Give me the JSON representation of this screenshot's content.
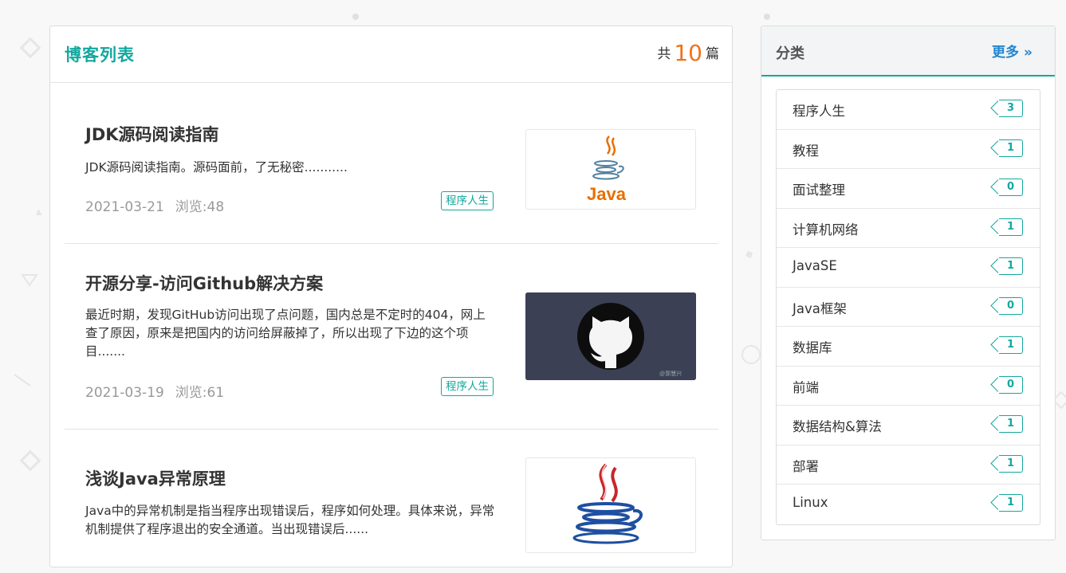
{
  "main": {
    "title": "博客列表",
    "total_prefix": "共",
    "total_count": "10",
    "total_suffix": "篇"
  },
  "posts": [
    {
      "title": "JDK源码阅读指南",
      "desc": "JDK源码阅读指南。源码面前，了无秘密...........",
      "date": "2021-03-21",
      "views": "浏览:48",
      "tag": "程序人生",
      "thumb": "java-logo-icon"
    },
    {
      "title": "开源分享-访问Github解决方案",
      "desc": "最近时期，发现GitHub访问出现了点问题，国内总是不定时的404，网上查了原因，原来是把国内的访问给屏蔽掉了，所以出现了下边的这个项目.......",
      "date": "2021-03-19",
      "views": "浏览:61",
      "tag": "程序人生",
      "thumb": "github-octocat-icon"
    },
    {
      "title": "浅谈Java异常原理",
      "desc": "Java中的异常机制是指当程序出现错误后，程序如何处理。具体来说，异常机制提供了程序退出的安全通道。当出现错误后......",
      "thumb": "java-cup-icon"
    }
  ],
  "sidebar": {
    "title": "分类",
    "more_label": "更多",
    "categories": [
      {
        "name": "程序人生",
        "count": "3"
      },
      {
        "name": "教程",
        "count": "1"
      },
      {
        "name": "面试整理",
        "count": "0"
      },
      {
        "name": "计算机网络",
        "count": "1"
      },
      {
        "name": "JavaSE",
        "count": "1"
      },
      {
        "name": "Java框架",
        "count": "0"
      },
      {
        "name": "数据库",
        "count": "1"
      },
      {
        "name": "前端",
        "count": "0"
      },
      {
        "name": "数据结构&算法",
        "count": "1"
      },
      {
        "name": "部署",
        "count": "1"
      },
      {
        "name": "Linux",
        "count": "1"
      }
    ]
  },
  "colors": {
    "accent": "#13a89e",
    "orange": "#f2711c",
    "link": "#2185d0"
  }
}
